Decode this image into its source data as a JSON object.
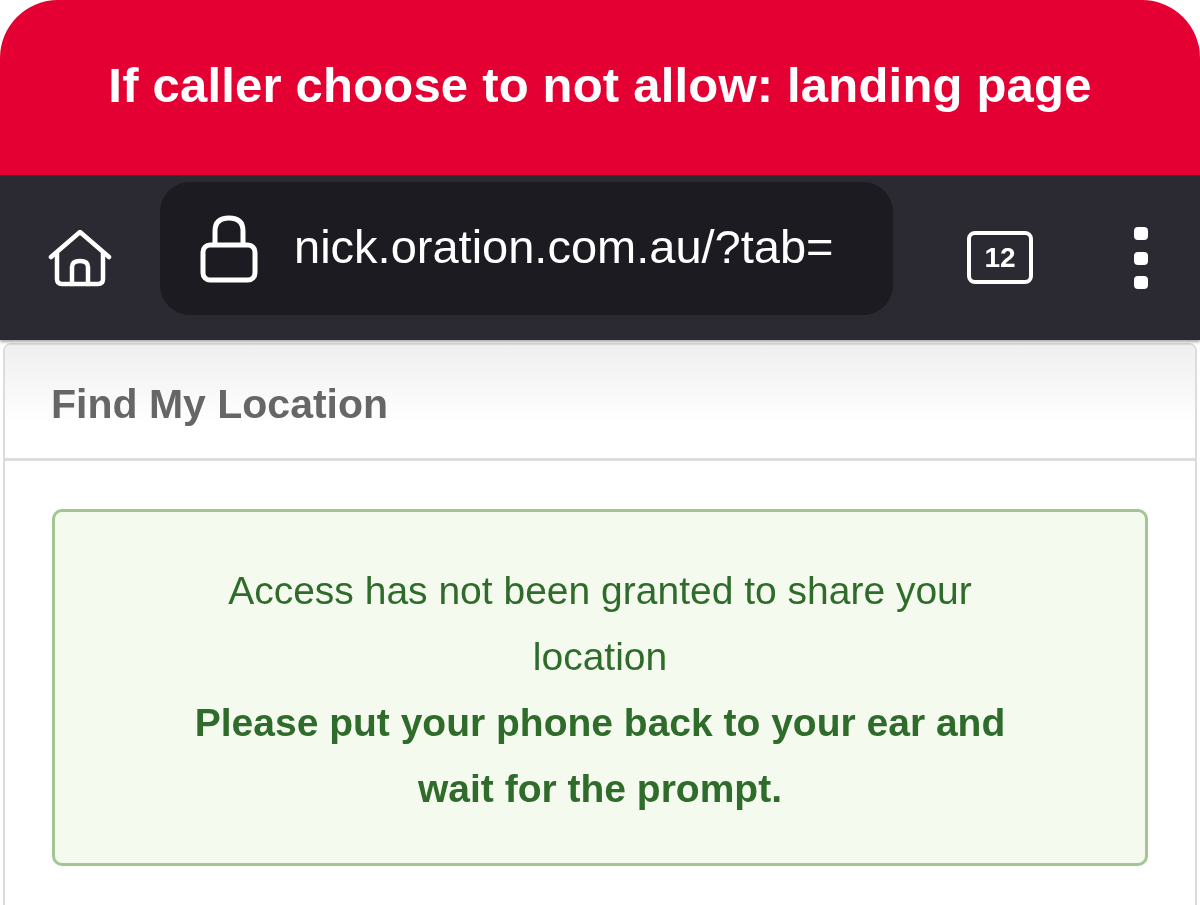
{
  "banner": {
    "title": "If caller choose to not allow: landing page"
  },
  "browser_bar": {
    "url": "nick.oration.com.au/?tab=",
    "tab_count": "12"
  },
  "panel": {
    "heading": "Find My Location",
    "alert": {
      "message": "Access has not been granted to share your location",
      "instruction": "Please put your phone back to your ear and wait for the prompt."
    }
  }
}
